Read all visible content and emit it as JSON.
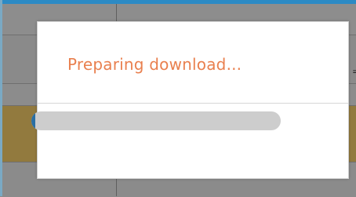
{
  "dialog": {
    "title": "Preparing download..."
  },
  "progress": {
    "value_fraction": 0.015
  },
  "colors": {
    "title": "#e9804f",
    "progress_fill": "#2b6fa3",
    "progress_track": "#cdcdcd",
    "header_accent": "#2c8ac4",
    "highlight_row": "#927a3e"
  },
  "background": {
    "visible_glyph": "="
  }
}
